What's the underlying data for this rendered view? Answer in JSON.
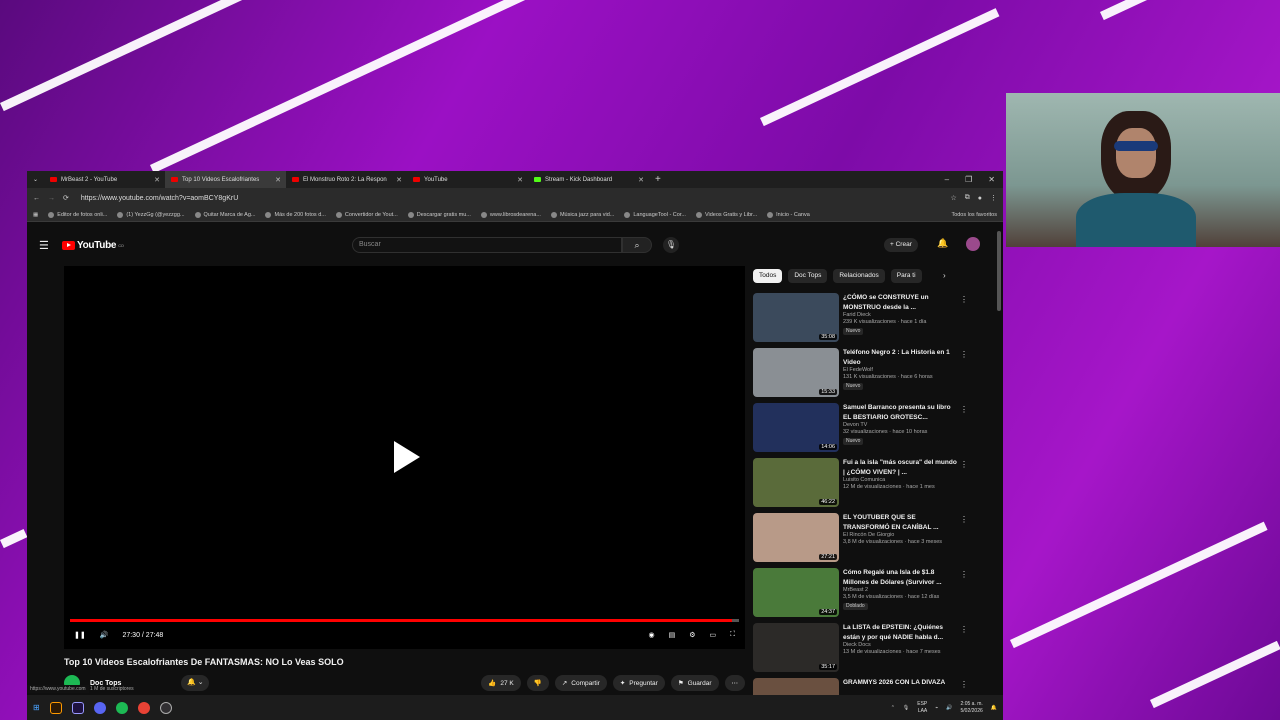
{
  "browser": {
    "tabs": [
      {
        "label": "MrBeast 2 - YouTube",
        "icon": "youtube-icon"
      },
      {
        "label": "Top 10 Videos Escalofriantes",
        "icon": "youtube-icon",
        "active": true
      },
      {
        "label": "El Monstruo Roto 2: La Respon",
        "icon": "youtube-icon"
      },
      {
        "label": "YouTube",
        "icon": "youtube-icon"
      },
      {
        "label": "Stream - Kick Dashboard",
        "icon": "kick-icon"
      }
    ],
    "url": "https://www.youtube.com/watch?v=aomBCY8gKrU",
    "bookmarks": [
      "Editor de fotos onli...",
      "(1) YezzGg (@yezzgg...",
      "Quitar Marca de Ag...",
      "Más de 200 fotos d...",
      "Convertidor de Yout...",
      "Descargar gratis mu...",
      "www.librosdearena...",
      "Música jazz para vid...",
      "LanguageTool - Cor...",
      "Videos Gratis y Libr...",
      "Inicio - Canva"
    ],
    "all_bookmarks": "Todos los favoritos",
    "status_url": "https://www.youtube.com"
  },
  "youtube": {
    "logo": "YouTube",
    "logo_sup": "CO",
    "search_placeholder": "Buscar",
    "create_label": "Crear",
    "player": {
      "time": "27:30 / 27:48",
      "progress": 0.989
    },
    "video_title": "Top 10 Videos Escalofriantes De FANTASMAS: NO Lo Veas SOLO",
    "channel": "Doc Tops",
    "subscribers": "1 M de suscriptores",
    "likes": "27 K",
    "share_label": "Compartir",
    "ask_label": "Preguntar",
    "save_label": "Guardar",
    "chips": [
      "Todos",
      "Doc Tops",
      "Relacionados",
      "Para ti"
    ],
    "recommendations": [
      {
        "title": "¿CÓMO se CONSTRUYE un MONSTRUO desde la ...",
        "channel": "Farid Dieck",
        "meta": "239 K visualizaciones · hace 1 día",
        "badge": "Nuevo",
        "duration": "35:08",
        "thumb": "#3b4a5c"
      },
      {
        "title": "Teléfono Negro 2 : La Historia en 1 Video",
        "channel": "El FedeWolf",
        "meta": "131 K visualizaciones · hace 6 horas",
        "badge": "Nuevo",
        "duration": "15:33",
        "thumb": "#8a8f94"
      },
      {
        "title": "Samuel Barranco presenta su libro EL BESTIARIO GROTESC...",
        "channel": "Devon TV",
        "meta": "32 visualizaciones · hace 10 horas",
        "badge": "Nuevo",
        "duration": "14:06",
        "thumb": "#22305c"
      },
      {
        "title": "Fui a la isla \"más oscura\" del mundo | ¿CÓMO VIVEN? | ...",
        "channel": "Luisito Comunica",
        "meta": "12 M de visualizaciones · hace 1 mes",
        "badge": "",
        "duration": "46:22",
        "thumb": "#5a6b3a"
      },
      {
        "title": "EL YOUTUBER QUE SE TRANSFORMÓ EN CANÍBAL ...",
        "channel": "El Rincón De Giorgio",
        "meta": "3,8 M de visualizaciones · hace 3 meses",
        "badge": "",
        "duration": "27:21",
        "thumb": "#b89a88"
      },
      {
        "title": "Cómo Regalé una Isla de $1.8 Millones de Dólares (Survivor ...",
        "channel": "MrBeast 2",
        "meta": "3,5 M de visualizaciones · hace 12 días",
        "badge": "Doblado",
        "duration": "24:37",
        "thumb": "#4a7a3a"
      },
      {
        "title": "La LISTA de EPSTEIN: ¿Quiénes están y por qué NADIE habla d...",
        "channel": "Dieck Docs",
        "meta": "13 M de visualizaciones · hace 7 meses",
        "badge": "",
        "duration": "35:17",
        "thumb": "#2c2a28"
      },
      {
        "title": "GRAMMYS 2026 CON LA DIVAZA",
        "channel": "",
        "meta": "",
        "badge": "",
        "duration": "",
        "thumb": "#6a5040"
      }
    ]
  },
  "taskbar": {
    "lang": "ESP",
    "lang2": "LAA",
    "time": "2:05 a. m.",
    "date": "5/02/2026"
  }
}
